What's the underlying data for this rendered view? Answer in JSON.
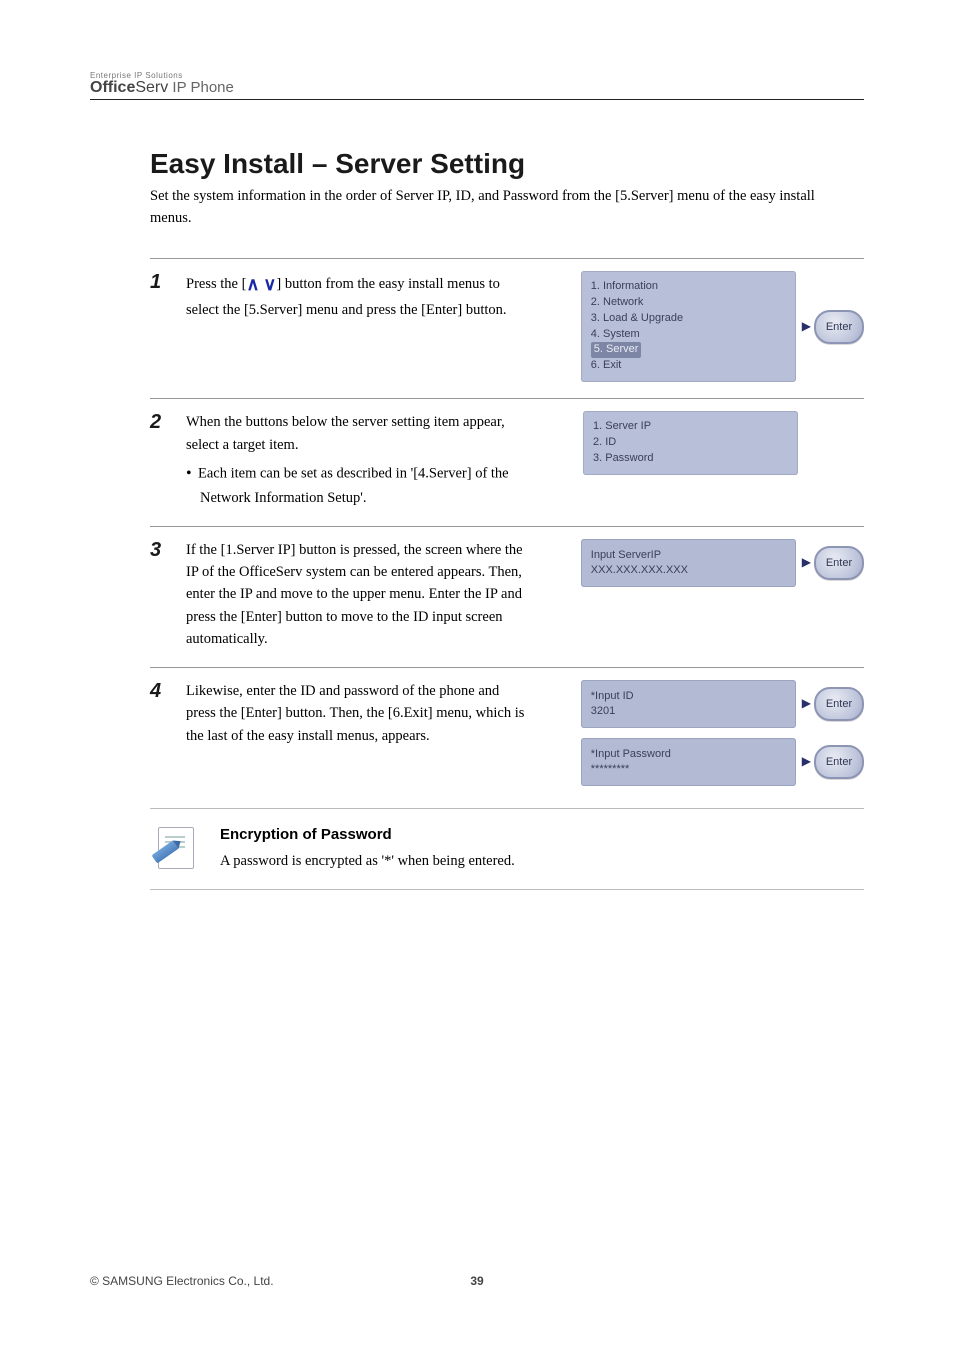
{
  "brand": {
    "small_line": "Enterprise IP Solutions",
    "bold": "Office",
    "reg": "Serv",
    "suffix": " IP Phone"
  },
  "heading": "Easy Install – Server Setting",
  "lead": "Set the system information in the order of Server IP, ID, and Password from the [5.Server] menu of the easy install menus.",
  "steps": [
    {
      "num": "1",
      "text_before_nav": "Press the [",
      "text_after_nav": "] button from the easy install menus to select the [5.Server] menu and press the [Enter] button.",
      "menu": {
        "items": [
          "1. Information",
          "2. Network",
          "3. Load & Upgrade",
          "4. System",
          "5. Server",
          "6. Exit"
        ],
        "selected_index": 4
      },
      "show_enter": true
    },
    {
      "num": "2",
      "text": "When the buttons below the server setting item appear, select a target item.",
      "bullets": [
        "Each item can be set as described in '[4.Server] of the Network Information Setup'."
      ],
      "menu": {
        "items": [
          "1. Server IP",
          "2. ID",
          "3. Password"
        ]
      },
      "show_enter": false
    },
    {
      "num": "3",
      "text": "If the [1.Server IP] button is pressed, the screen where the IP of the OfficeServ system can be entered appears. Then, enter the IP and move to the upper menu. Enter the IP and press the [Enter] button to move to the ID input screen automatically.",
      "lcd": {
        "line1": "Input ServerIP",
        "line2": "XXX.XXX.XXX.XXX"
      },
      "show_enter": true
    },
    {
      "num": "4",
      "text": "Likewise, enter the ID and password of the phone and press the [Enter] button. Then, the [6.Exit] menu, which is the last of the easy install menus, appears.",
      "lcds": [
        {
          "line1": "*Input ID",
          "line2": "3201"
        },
        {
          "line1": "*Input Password",
          "line2": "*********"
        }
      ],
      "show_enter": true
    }
  ],
  "nav_keys": {
    "up": "∧",
    "down": "∨"
  },
  "enter_label": "Enter",
  "note": {
    "label": "Encryption of Password",
    "body": "A password is encrypted as '*' when being entered."
  },
  "footer": {
    "copyright": "© SAMSUNG Electronics Co., Ltd.",
    "page": "39"
  }
}
